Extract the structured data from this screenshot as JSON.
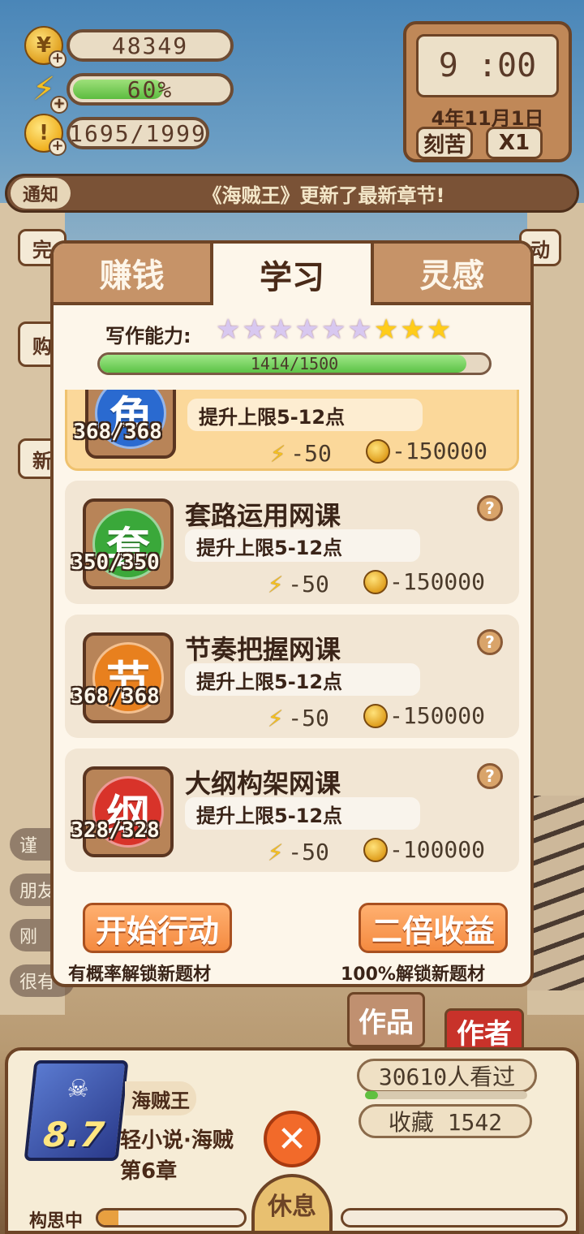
{
  "hud": {
    "coins": "48349",
    "energy": "60%",
    "energy_level": 0.6,
    "inspiration": "1695/1999"
  },
  "clock": {
    "time": "9 :00",
    "date": "4年11月1日",
    "mode": "刻苦",
    "speed": "X1"
  },
  "notice": {
    "tag": "通知",
    "text": "《海贼王》更新了最新章节!"
  },
  "peek": {
    "left_top": "完",
    "left_mid": "购",
    "left_low": "新",
    "right_top": "动",
    "chips": [
      "谨",
      "朋友",
      "刚",
      "很有"
    ]
  },
  "tabs": [
    {
      "label": "赚钱",
      "active": false
    },
    {
      "label": "学习",
      "active": true
    },
    {
      "label": "灵感",
      "active": false
    }
  ],
  "ability": {
    "label": "写作能力:",
    "rainbow_stars": 6,
    "gold_stars": 3,
    "progress_text": "1414/1500",
    "progress": 0.9427
  },
  "courses": [
    {
      "char": "角",
      "color": "#2a6ad0",
      "count": "368/368",
      "title": "",
      "desc": "提升上限5-12点",
      "energy": "-50",
      "coins": "-150000",
      "highlight": true
    },
    {
      "char": "套",
      "color": "#3aa83a",
      "count": "350/350",
      "title": "套路运用网课",
      "desc": "提升上限5-12点",
      "energy": "-50",
      "coins": "-150000",
      "highlight": false
    },
    {
      "char": "节",
      "color": "#e8801e",
      "count": "368/368",
      "title": "节奏把握网课",
      "desc": "提升上限5-12点",
      "energy": "-50",
      "coins": "-150000",
      "highlight": false
    },
    {
      "char": "纲",
      "color": "#d8332a",
      "count": "328/328",
      "title": "大纲构架网课",
      "desc": "提升上限5-12点",
      "energy": "-50",
      "coins": "-100000",
      "highlight": false
    }
  ],
  "actions": {
    "start_label": "开始行动",
    "start_note": "有概率解锁新题材",
    "double_label": "二倍收益",
    "double_note": "100%解锁新题材"
  },
  "bottom": {
    "works_tab": "作品",
    "author_tab": "作者",
    "score": "8.7",
    "novel_title": "海贼王",
    "genre": "轻小说·海贼",
    "chapter": "第6章",
    "views": "30610人看过",
    "views_level": 0.08,
    "favorites": "收藏 1542",
    "rest_label": "休息",
    "thinking_label": "构思中",
    "thinking_level": 0.14
  }
}
